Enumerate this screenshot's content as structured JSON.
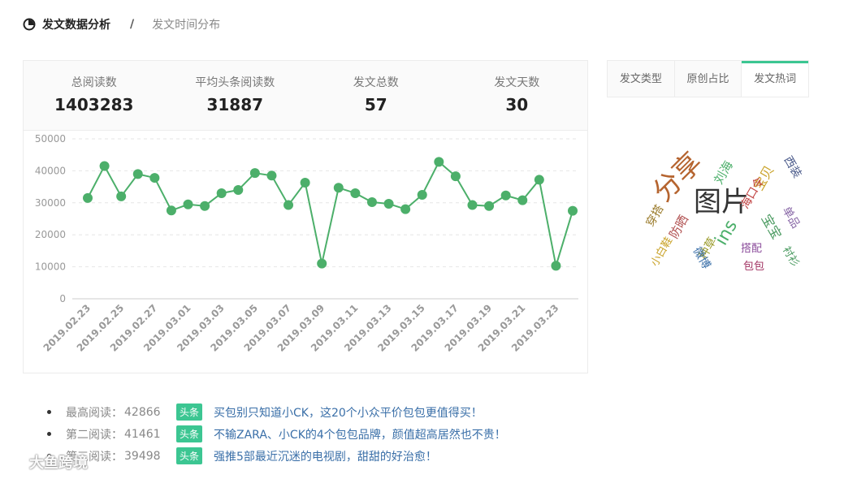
{
  "breadcrumb": {
    "current": "发文数据分析",
    "separator": "/",
    "sub": "发文时间分布"
  },
  "stats": [
    {
      "label": "总阅读数",
      "value": "1403283"
    },
    {
      "label": "平均头条阅读数",
      "value": "31887"
    },
    {
      "label": "发文总数",
      "value": "57"
    },
    {
      "label": "发文天数",
      "value": "30"
    }
  ],
  "tabs": [
    {
      "label": "发文类型",
      "active": false
    },
    {
      "label": "原创占比",
      "active": false
    },
    {
      "label": "发文热词",
      "active": true
    }
  ],
  "colors": {
    "accent": "#3cc692",
    "line": "#4caf6a",
    "link": "#3a6fa8"
  },
  "chart_data": {
    "type": "line",
    "title": "",
    "xlabel": "",
    "ylabel": "",
    "ylim": [
      0,
      50000
    ],
    "yticks": [
      "0",
      "10000",
      "20000",
      "30000",
      "40000",
      "50000"
    ],
    "xticks": [
      "2019.02.23",
      "2019.02.25",
      "2019.02.27",
      "2019.03.01",
      "2019.03.03",
      "2019.03.05",
      "2019.03.07",
      "2019.03.09",
      "2019.03.11",
      "2019.03.13",
      "2019.03.15",
      "2019.03.17",
      "2019.03.19",
      "2019.03.21",
      "2019.03.23"
    ],
    "x": [
      "2019.02.23",
      "2019.02.24",
      "2019.02.25",
      "2019.02.26",
      "2019.02.27",
      "2019.02.28",
      "2019.03.01",
      "2019.03.02",
      "2019.03.03",
      "2019.03.04",
      "2019.03.05",
      "2019.03.06",
      "2019.03.07",
      "2019.03.08",
      "2019.03.09",
      "2019.03.10",
      "2019.03.11",
      "2019.03.12",
      "2019.03.13",
      "2019.03.14",
      "2019.03.15",
      "2019.03.16",
      "2019.03.17",
      "2019.03.18",
      "2019.03.19",
      "2019.03.20",
      "2019.03.21",
      "2019.03.22",
      "2019.03.23",
      "2019.03.24"
    ],
    "values": [
      31500,
      41500,
      32000,
      39000,
      37800,
      27600,
      29500,
      29000,
      33000,
      34000,
      39300,
      38500,
      29300,
      36300,
      11000,
      34700,
      33000,
      30200,
      29700,
      28000,
      32500,
      42800,
      38300,
      29300,
      29000,
      32300,
      30800,
      37200,
      10300,
      27500
    ],
    "grid": true
  },
  "wordcloud": [
    {
      "text": "分享",
      "color": "#b5642f"
    },
    {
      "text": "图片",
      "color": "#333333"
    },
    {
      "text": "ins",
      "color": "#4caf6a"
    },
    {
      "text": "刘海",
      "color": "#4caf6a"
    },
    {
      "text": "宝贝",
      "color": "#c9a227"
    },
    {
      "text": "西装",
      "color": "#4a5a8a"
    },
    {
      "text": "海口令",
      "color": "#c04040"
    },
    {
      "text": "穿搭",
      "color": "#9a7a2a"
    },
    {
      "text": "防晒",
      "color": "#b05050"
    },
    {
      "text": "单品",
      "color": "#8a6aa8"
    },
    {
      "text": "宝宝",
      "color": "#4a9a60"
    },
    {
      "text": "种草",
      "color": "#9a9a2a"
    },
    {
      "text": "小白鞋",
      "color": "#c9a227"
    },
    {
      "text": "微博",
      "color": "#3a6fa8"
    },
    {
      "text": "搭配",
      "color": "#8a4a9a"
    },
    {
      "text": "衬衫",
      "color": "#4a9a60"
    },
    {
      "text": "包包",
      "color": "#a03060"
    }
  ],
  "top_articles": [
    {
      "rank_label": "最高阅读：",
      "reads": "42866",
      "tag": "头条",
      "title": "买包别只知道小CK，这20个小众平价包包更值得买！"
    },
    {
      "rank_label": "第二阅读：",
      "reads": "41461",
      "tag": "头条",
      "title": "不输ZARA、小CK的4个包包品牌，颜值超高居然也不贵！"
    },
    {
      "rank_label": "第三阅读：",
      "reads": "39498",
      "tag": "头条",
      "title": "强推5部最近沉迷的电视剧，甜甜的好治愈！"
    }
  ],
  "watermark": "大鱼跨境"
}
